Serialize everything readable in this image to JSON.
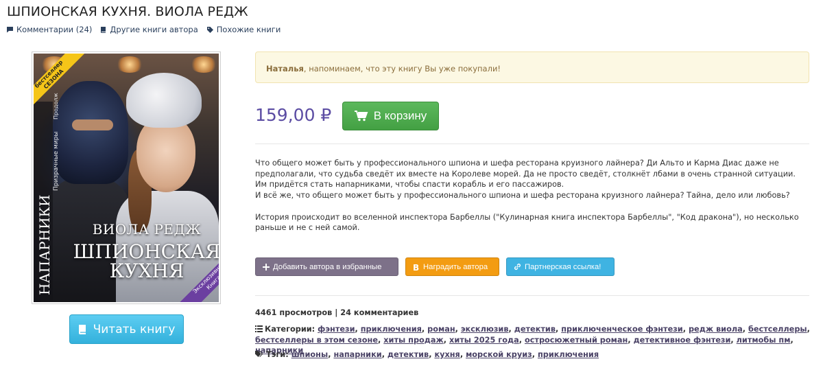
{
  "page": {
    "title": "ШПИОНСКАЯ КУХНЯ. ВИОЛА РЕДЖ"
  },
  "links": [
    {
      "label": "Комментарии (24)",
      "icon": "comment-icon"
    },
    {
      "label": "Другие книги автора",
      "icon": "book-icon"
    },
    {
      "label": "Похожие книги",
      "icon": "tag-icon"
    }
  ],
  "cover": {
    "author": "ВИОЛА РЕДЖ",
    "title_line1": "ШПИОНСКАЯ",
    "title_line2": "КУХНЯ",
    "series": "НАПАРНИКИ",
    "world": "Призрачные миры",
    "badge_top_line1": "бестселлер",
    "badge_top_line2": "СЕЗОНА",
    "badge_bottom_line1": "Эксклюзивная",
    "badge_bottom_line2": "Книга",
    "side_small": "Продолж"
  },
  "read_button": {
    "label": "Читать книгу",
    "icon": "book-icon",
    "color": "#34b1dc"
  },
  "alert": {
    "name": "Наталья",
    "text": ", напоминаем, что эту книгу Вы уже покупали!"
  },
  "purchase": {
    "price": "159,00 ₽",
    "cart_label": "В корзину",
    "cart_color": "#5cb85c",
    "price_color": "#5b4ca3"
  },
  "description": {
    "p1": "Что общего может быть у профессионального шпиона и шефа ресторана круизного лайнера? Ди Альто и Карма Диас даже не предполагали, что судьба сведёт их вместе на Королеве морей. Да не просто сведёт, столкнёт лбами в очень странной ситуации. Им придётся стать напарниками, чтобы спасти корабль и его пассажиров.",
    "p2": "И всё же, что общего может быть у профессионального шпиона и шефа ресторана круизного лайнера? Тайна, дело или любовь?",
    "p3": "История происходит во вселенной инспектора Барбеллы (\"Кулинарная книга инспектора Барбеллы\", \"Код дракона\"), но несколько раньше и не с ней самой."
  },
  "actions": {
    "favorite": "Добавить автора в избранные",
    "reward": "Наградить автора",
    "partner": "Партнерская ссылка!"
  },
  "stats": "4461 просмотров | 24 комментариев",
  "categories": {
    "label": "Категории:",
    "items": [
      "фэнтези",
      "приключения",
      "роман",
      "эксклюзив",
      "детектив",
      "приключенческое фэнтези",
      "редж виола",
      "бестселлеры",
      "бестселлеры в этом сезоне",
      "хиты продаж",
      "хиты 2025 года",
      "остросюжетный роман",
      "детективное фэнтези",
      "литмобы пм",
      "напарники"
    ]
  },
  "tags": {
    "label": "Тэги:",
    "items": [
      "шпионы",
      "напарники",
      "детектив",
      "кухня",
      "морской круиз",
      "приключения"
    ]
  }
}
